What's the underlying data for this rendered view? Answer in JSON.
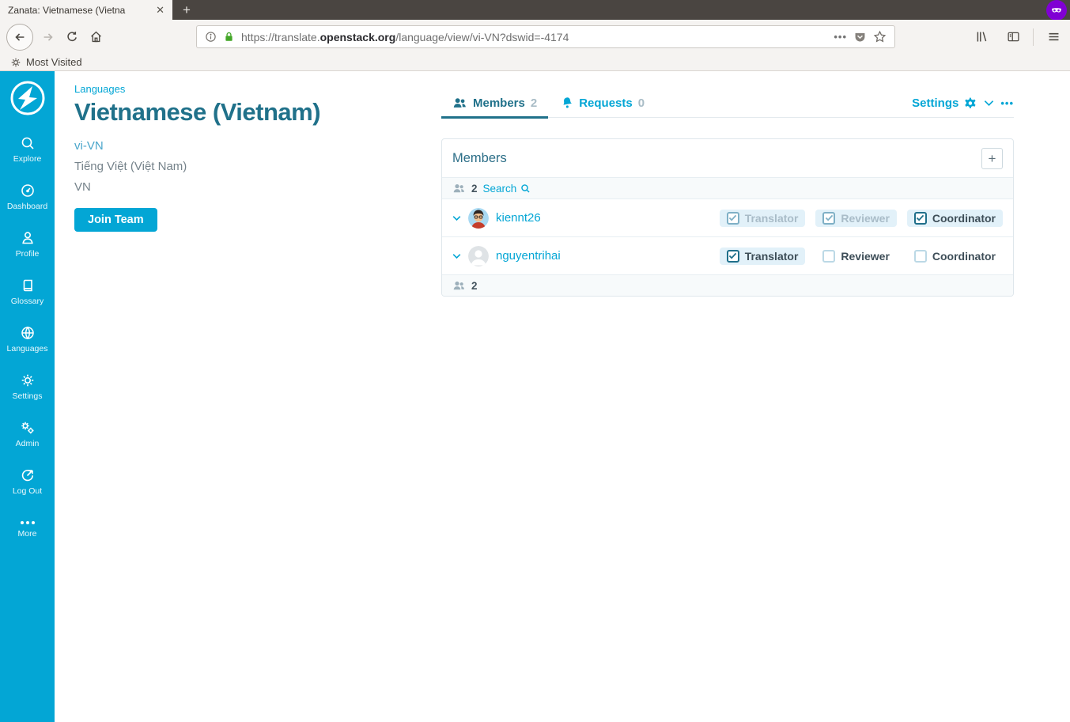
{
  "browser": {
    "tab_title": "Zanata: Vietnamese (Vietna",
    "close_glyph": "✕",
    "new_tab_glyph": "+",
    "url_prefix": "https://translate.",
    "url_domain": "openstack.org",
    "url_path": "/language/view/vi-VN?dswid=-4174",
    "page_action_dots": "•••",
    "bookmarks_label": "Most Visited"
  },
  "sidebar": {
    "items": [
      {
        "label": "Explore"
      },
      {
        "label": "Dashboard"
      },
      {
        "label": "Profile"
      },
      {
        "label": "Glossary"
      },
      {
        "label": "Languages"
      },
      {
        "label": "Settings"
      },
      {
        "label": "Admin"
      },
      {
        "label": "Log Out"
      },
      {
        "label": "More"
      }
    ],
    "more_dots": "•••"
  },
  "page": {
    "breadcrumb": "Languages",
    "title": "Vietnamese (Vietnam)",
    "locale_code": "vi-VN",
    "native_name": "Tiếng Việt (Việt Nam)",
    "region": "VN",
    "join_button": "Join Team"
  },
  "panel_tabs": {
    "members_label": "Members",
    "members_count": "2",
    "requests_label": "Requests",
    "requests_count": "0",
    "settings_label": "Settings",
    "more_dots": "•••"
  },
  "members_panel": {
    "title": "Members",
    "add_button": "+",
    "member_count": "2",
    "search_label": "Search",
    "footer_count": "2",
    "members": [
      {
        "username": "kiennt26",
        "roles": [
          {
            "label": "Translator",
            "state": "checked-muted"
          },
          {
            "label": "Reviewer",
            "state": "checked-muted"
          },
          {
            "label": "Coordinator",
            "state": "checked"
          }
        ]
      },
      {
        "username": "nguyentrihai",
        "roles": [
          {
            "label": "Translator",
            "state": "checked"
          },
          {
            "label": "Reviewer",
            "state": "unchecked"
          },
          {
            "label": "Coordinator",
            "state": "unchecked"
          }
        ]
      }
    ]
  },
  "colors": {
    "brand_blue": "#03A6D5",
    "heading_teal": "#20718A",
    "checked_pill_bg": "#e2f1f9",
    "chrome_dark": "#4a4541",
    "chrome_light": "#f5f3f1",
    "lock_green": "#43a627",
    "private_purple": "#8000d4"
  }
}
